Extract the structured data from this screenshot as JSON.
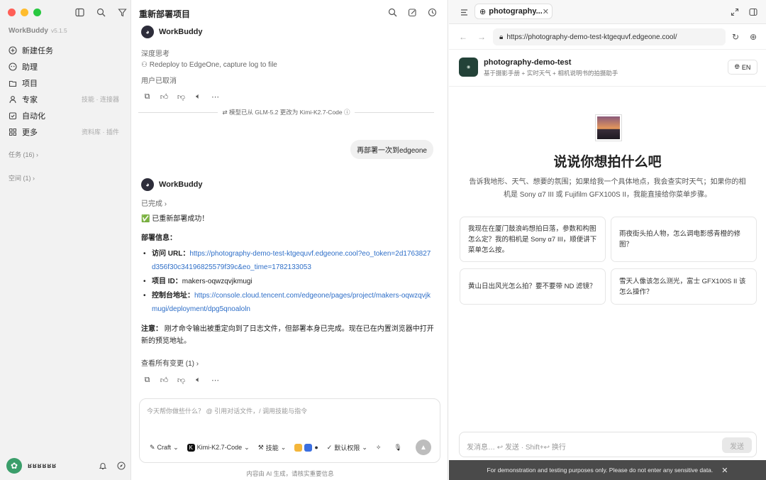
{
  "colors": {
    "red": "#ff5f57",
    "yellow": "#febc2e",
    "green": "#28c840",
    "link": "#2f6fc8"
  },
  "sidebar": {
    "brand": "WorkBuddy",
    "version": "v5.1.5",
    "items": [
      {
        "label": "新建任务",
        "icon": "plus-circle-icon",
        "hint": ""
      },
      {
        "label": "助理",
        "icon": "assistant-icon",
        "hint": ""
      },
      {
        "label": "项目",
        "icon": "project-icon",
        "hint": ""
      },
      {
        "label": "专家",
        "icon": "expert-icon",
        "hint": "技能 · 连接器"
      },
      {
        "label": "自动化",
        "icon": "automation-icon",
        "hint": ""
      },
      {
        "label": "更多",
        "icon": "more-grid-icon",
        "hint": "资料库 · 插件"
      }
    ],
    "tasks_label": "任务 (16)",
    "space_label": "空间 (1)",
    "user_name": "ʁʁʁʁʁʁ"
  },
  "chat": {
    "title": "重新部署项目",
    "bot_name": "WorkBuddy",
    "think_label": "深度思考",
    "tool_call": "Redeploy to EdgeOne, capture log to file",
    "user_cancel": "用户已取消",
    "model_switch": "模型已从 GLM-5.2 更改为 Kimi-K2.7-Code",
    "user_message": "再部署一次到edgeone",
    "status_done": "已完成",
    "success": "✅ 已重新部署成功！",
    "deploy_info_title": "部署信息：",
    "url_label": "访问 URL：",
    "url_value": "https://photography-demo-test-ktgequvf.edgeone.cool?eo_token=2d1763827d356f30c34196825579f39c&eo_time=1782133053",
    "project_id_label": "项目 ID：",
    "project_id_value": "makers-oqwzqvjkmugi",
    "console_label": "控制台地址：",
    "console_value": "https://console.cloud.tencent.com/edgeone/pages/project/makers-oqwzqvjkmugi/deployment/dpg5qnoaloln",
    "note_label": "注意：",
    "note_text": "刚才命令输出被重定向到了日志文件，但部署本身已完成。现在已在内置浏览器中打开新的预览地址。",
    "view_changes": "查看所有变更 (1)",
    "input_placeholder": "今天帮你做些什么？ @ 引用对话文件，/ 调用技能与指令",
    "mode": "Craft",
    "model": "Kimi-K2.7-Code",
    "skills": "技能",
    "permission": "默认权限",
    "disclaimer": "内容由 AI 生成，请核实重要信息"
  },
  "browser": {
    "tab_title": "photography...",
    "url": "https://photography-demo-test-ktgequvf.edgeone.cool/",
    "site_name": "photography-demo-test",
    "site_subtitle": "基于摄影手册 + 实时天气 + 相机说明书的拍摄助手",
    "lang": "EN",
    "hero_title": "说说你想拍什么吧",
    "hero_desc": "告诉我地形、天气、想要的氛围；如果给我一个具体地点，我会查实时天气；如果你的相机是 Sony α7 III 或 Fujifilm GFX100S II，我能直接给你菜单步骤。",
    "cards": [
      "我现在在厦门鼓浪屿想拍日落，参数和构图怎么定？我的相机是 Sony α7 III，顺便讲下菜单怎么按。",
      "雨夜街头拍人物，怎么调电影感青橙的修图？",
      "黄山日出风光怎么拍？要不要带 ND 滤镜？",
      "雪天人像该怎么测光，富士 GFX100S II 该怎么操作？"
    ],
    "msg_placeholder": "发消息… ↩ 发送 · Shift+↩ 换行",
    "send": "发送",
    "notice": "For demonstration and testing purposes only. Please do not enter any sensitive data."
  }
}
